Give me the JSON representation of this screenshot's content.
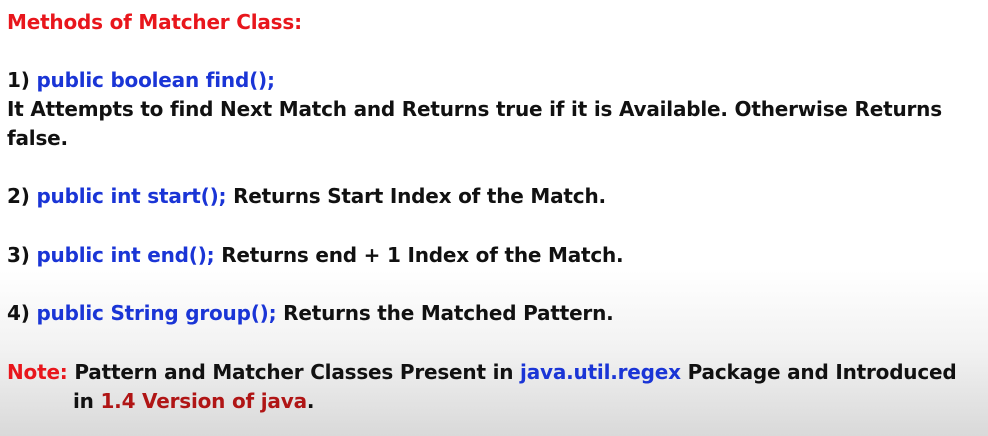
{
  "title": "Methods of Matcher Class:",
  "methods": [
    {
      "number": "1)",
      "signature": "public boolean find();",
      "description_line1": "It Attempts to find Next Match and Returns true if it is Available. Otherwise Returns",
      "description_line2": "false."
    },
    {
      "number": "2)",
      "signature": "public int start();",
      "description": "Returns Start Index of the Match."
    },
    {
      "number": "3)",
      "signature": "public int end();",
      "description": "Returns end + 1 Index of the Match."
    },
    {
      "number": "4)",
      "signature": "public String group();",
      "description": "Returns the Matched Pattern."
    }
  ],
  "note": {
    "label": "Note:",
    "text_a": "Pattern and Matcher Classes Present in",
    "package": "java.util.regex",
    "text_b": "Package and Introduced",
    "text_c": "in",
    "version": "1.4 Version of java",
    "end": "."
  },
  "colors": {
    "heading_red": "#e8161c",
    "code_blue": "#1a35d6",
    "version_darkred": "#b01515",
    "text_black": "#111111"
  }
}
